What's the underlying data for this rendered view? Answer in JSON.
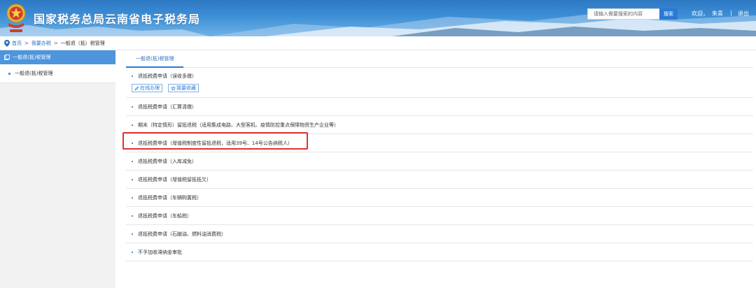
{
  "header": {
    "title": "国家税务总局云南省电子税务局",
    "search_placeholder": "请输入需要搜索的内容",
    "search_button": "搜索",
    "welcome": "欢迎，",
    "username": "朱青",
    "divider": "|",
    "logout": "退出",
    "emblem_icon": "tax-emblem-icon"
  },
  "breadcrumb": {
    "home": "首页",
    "sep1": ">",
    "level2": "我要办税",
    "sep2": ">",
    "current": "一般退（抵）税管理"
  },
  "sidebar": {
    "header": "一般退(抵)税管理",
    "items": [
      {
        "label": "一般退(抵)税管理"
      }
    ]
  },
  "main": {
    "tab": "一般退(抵)税管理",
    "rows": [
      {
        "label": "退抵税费申请（误收多缴）"
      },
      {
        "label": "退抵税费申请（汇算清缴）"
      },
      {
        "label": "期末（特定情形）留抵退税（适用集成电路、大型客机、疫情防控重点保障物资生产企业等）"
      },
      {
        "label": "退抵税费申请（增值税制度性留抵退税，适用39号、14号公告纳税人）"
      },
      {
        "label": "退抵税费申请（入库减免）"
      },
      {
        "label": "退抵税费申请（增值税留抵抵欠）"
      },
      {
        "label": "退抵税费申请（车辆购置税）"
      },
      {
        "label": "退抵税费申请（车船税）"
      },
      {
        "label": "退抵税费申请（石脑油、燃料油消费税）"
      },
      {
        "label": "不予加收滞纳金审批"
      }
    ],
    "actions": {
      "online": "在线办理",
      "favorite": "我要收藏"
    }
  },
  "colors": {
    "header_blue": "#2e78c3",
    "accent": "#2a7ad5",
    "sidebar_header": "#4d95dc",
    "highlight": "#e03131"
  }
}
